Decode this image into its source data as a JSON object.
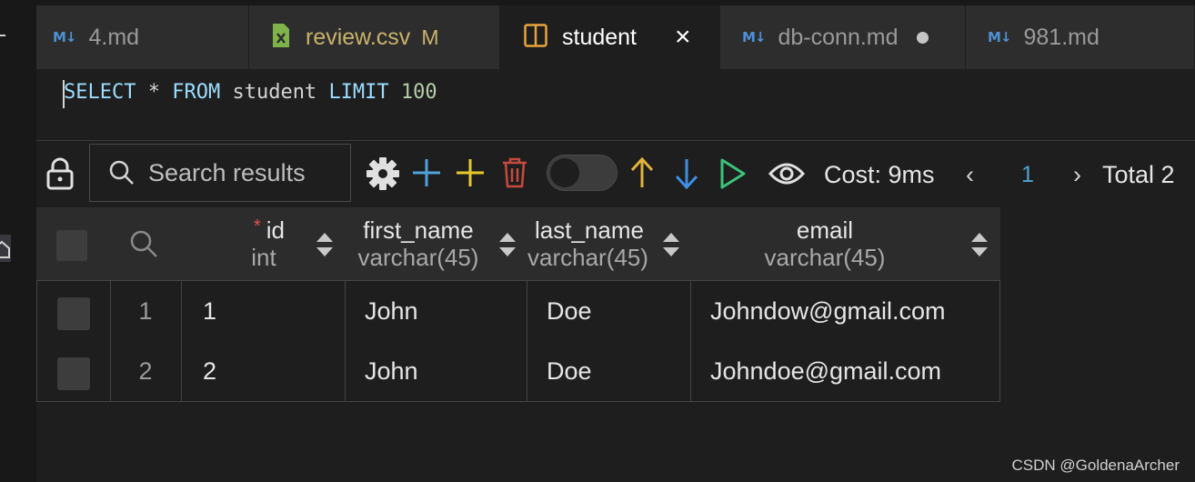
{
  "tabs": [
    {
      "label": "4.md",
      "icon": "markdown-icon"
    },
    {
      "label": "review.csv",
      "icon": "csv-file-icon",
      "status": "M"
    },
    {
      "label": "student",
      "icon": "table-layout-icon",
      "active": true
    },
    {
      "label": "db-conn.md",
      "icon": "markdown-icon",
      "dirty": true
    },
    {
      "label": "981.md",
      "icon": "markdown-icon"
    }
  ],
  "markdown_badge": "M↓",
  "query": {
    "select": "SELECT",
    "star": " * ",
    "from": "FROM",
    "table": " student ",
    "limit": "LIMIT",
    "value": " 100"
  },
  "toolbar": {
    "search_placeholder": "Search results",
    "cost": "Cost: 9ms",
    "prev": "‹",
    "page": "1",
    "next": "›",
    "total": "Total 2"
  },
  "columns": [
    {
      "name": "id",
      "type": "int",
      "required": true
    },
    {
      "name": "first_name",
      "type": "varchar(45)"
    },
    {
      "name": "last_name",
      "type": "varchar(45)"
    },
    {
      "name": "email",
      "type": "varchar(45)"
    }
  ],
  "required_mark": "*",
  "rows": [
    {
      "num": "1",
      "id": "1",
      "first_name": "John",
      "last_name": "Doe",
      "email": "Johndow@gmail.com"
    },
    {
      "num": "2",
      "id": "2",
      "first_name": "John",
      "last_name": "Doe",
      "email": "Johndoe@gmail.com"
    }
  ],
  "colors": {
    "add_blue": "#4fa3d8",
    "add_yellow": "#e5c92c",
    "delete_red": "#c74a3f",
    "arrow_up": "#e0b33c",
    "arrow_down": "#3e8ee6",
    "run_green": "#3cc27a"
  },
  "watermark": "CSDN @GoldenaArcher"
}
